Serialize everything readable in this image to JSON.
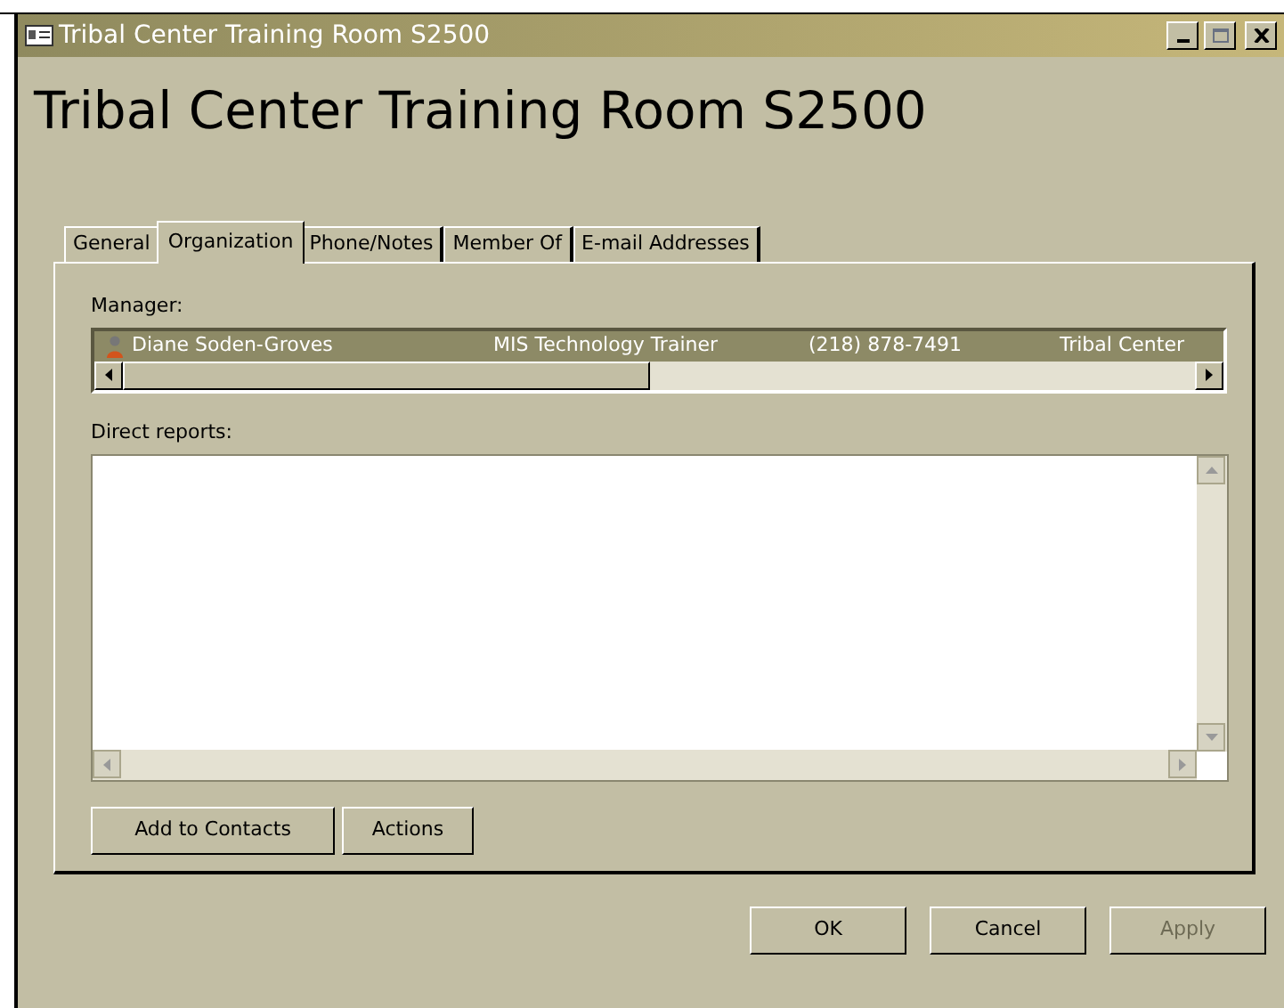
{
  "window": {
    "title": "Tribal Center Training Room S2500"
  },
  "heading": "Tribal Center Training Room S2500",
  "tabs": [
    {
      "label": "General",
      "selected": false
    },
    {
      "label": "Organization",
      "selected": true
    },
    {
      "label": "Phone/Notes",
      "selected": false
    },
    {
      "label": "Member Of",
      "selected": false
    },
    {
      "label": "E-mail Addresses",
      "selected": false
    }
  ],
  "manager": {
    "label": "Manager:",
    "rows": [
      {
        "name": "Diane Soden-Groves",
        "title": "MIS Technology Trainer",
        "phone": "(218) 878-7491",
        "office": "Tribal Center",
        "selected": true
      }
    ]
  },
  "direct_reports": {
    "label": "Direct reports:"
  },
  "panel_buttons": [
    {
      "label": "Add to Contacts",
      "disabled": false
    },
    {
      "label": "Actions",
      "disabled": false
    }
  ],
  "dialog_buttons": [
    {
      "label": "OK",
      "disabled": false
    },
    {
      "label": "Cancel",
      "disabled": false
    },
    {
      "label": "Apply",
      "disabled": true
    }
  ]
}
